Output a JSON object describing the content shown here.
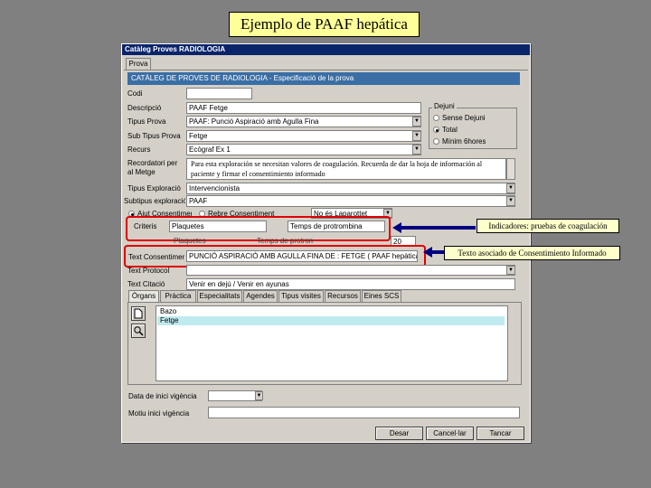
{
  "slide_title": "Ejemplo de PAAF hepática",
  "window_title": "Catàleg Proves RADIOLOGIA",
  "top_tab": "Prova",
  "section_header": "CATÀLEG DE PROVES DE RADIOLOGIA - Especificació de la prova",
  "fields": {
    "codi": {
      "label": "Codi",
      "value": ""
    },
    "descripcio": {
      "label": "Descripció",
      "value": "PAAF Fetge"
    },
    "tipus_prova": {
      "label": "Tipus Prova",
      "value": "PAAF: Punció Aspiració amb Agulla Fina"
    },
    "sub_tipus": {
      "label": "Sub Tipus Prova",
      "value": "Fetge"
    },
    "recurs": {
      "label": "Recurs",
      "value": "Ecògraf Ex 1"
    },
    "recordatori": {
      "label": "Recordatori per al Metge",
      "value": "Para esta exploración se necesitan valores de coagulación. Recuerda de dar la hoja de información al paciente y firmar el consentimiento informado"
    },
    "tipus_exploracio": {
      "label": "Tipus Exploració",
      "value": "Intervencionista"
    },
    "subtipus_exploracio": {
      "label": "Subtipus exploració",
      "value": "PAAF"
    },
    "criteris": {
      "label": "Criteris",
      "value1": "Plaquetes",
      "value2": "Temps de protrombina"
    },
    "hidden_row": {
      "a": "Plaquetes",
      "b": "Temps de protrombina",
      "num": "20"
    },
    "text_consentiment": {
      "label": "Text Consentiment",
      "value": "PUNCIÓ ASPIRACIÓ AMB AGULLA FINA DE : FETGE ( PAAF hepàtica )"
    },
    "text_protocol": {
      "label": "Text Protocol",
      "value": ""
    },
    "text_citacio": {
      "label": "Text Citació",
      "value": "Venir en dejú / Venir en ayunas"
    }
  },
  "radio_groups": {
    "dejuni": {
      "title": "Dejuni",
      "options": [
        "Sense Dejuni",
        "Total",
        "Mínim 6hores"
      ],
      "selected": 1
    },
    "ajut": {
      "options": [
        "Ajut Consentiment",
        "Rebre Consentiment"
      ],
      "selected": 0,
      "combo": "No és Laparottet"
    }
  },
  "inner_tabs": [
    "Òrgans",
    "Pràctica",
    "Especialitats",
    "Agendes",
    "Tipus visites",
    "Recursos",
    "Eines SCS"
  ],
  "organ_list": [
    {
      "label": "Bazo",
      "selected": false
    },
    {
      "label": "Fetge",
      "selected": true
    }
  ],
  "bottom": {
    "date_label": "Data de inici vigència",
    "date_value": "",
    "motiu_label": "Motiu inici vigència",
    "motiu_value": ""
  },
  "buttons": {
    "save": "Desar",
    "cancel": "Cancel·lar",
    "close": "Tancar"
  },
  "callouts": {
    "indicators": "Indicadores: pruebas de coagulación",
    "consent": "Texto asociado de Consentimiento Informado"
  },
  "colors": {
    "title_bg": "#ffff99",
    "header_blue": "#0a246a",
    "section_blue": "#3a6ea5",
    "red": "#e00000",
    "arrow": "#000080"
  }
}
